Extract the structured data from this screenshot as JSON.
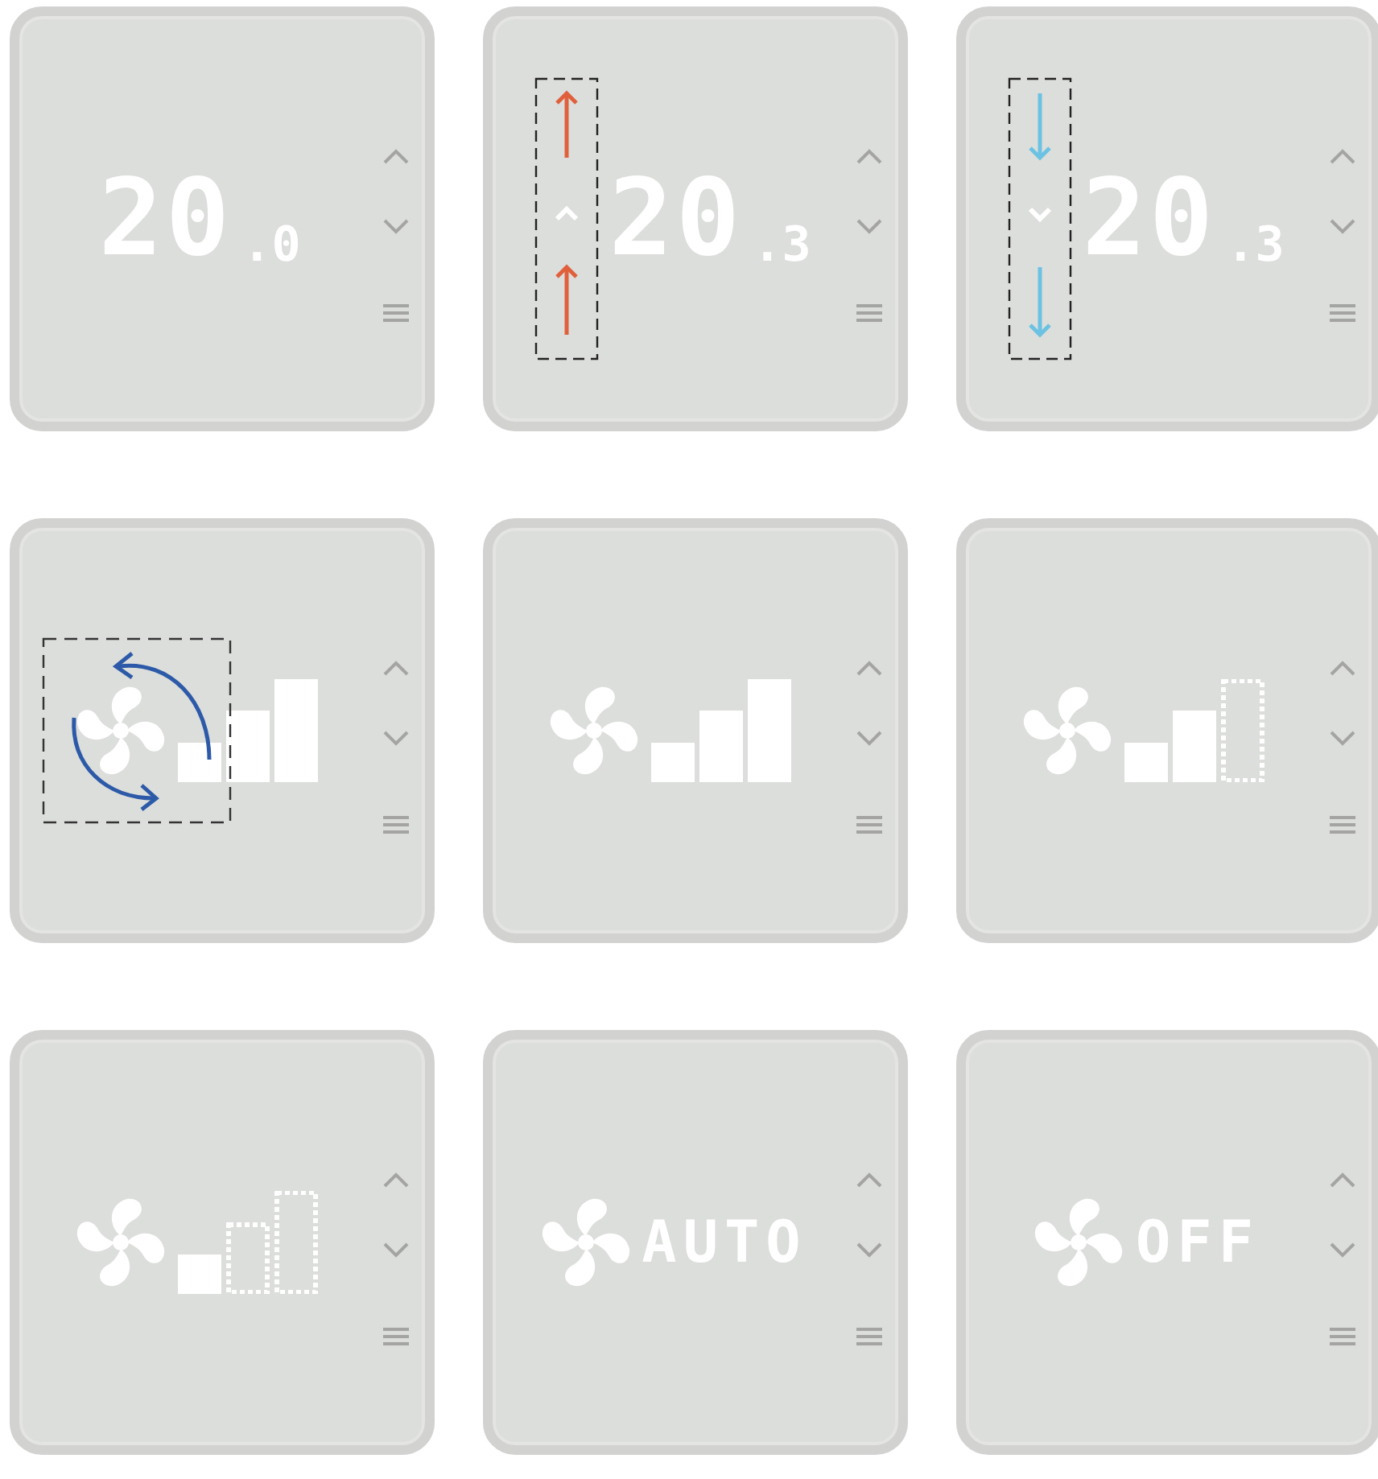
{
  "devices": [
    {
      "kind": "temperature",
      "whole": "20",
      "fraction": ".0",
      "rising": false,
      "falling": false
    },
    {
      "kind": "temperature",
      "whole": "20",
      "fraction": ".3",
      "rising": true,
      "falling": false
    },
    {
      "kind": "temperature",
      "whole": "20",
      "fraction": ".3",
      "rising": false,
      "falling": true
    },
    {
      "kind": "fan_level",
      "annotated": true,
      "bars": [
        {
          "filled": true
        },
        {
          "filled": true
        },
        {
          "filled": true
        }
      ]
    },
    {
      "kind": "fan_level",
      "annotated": false,
      "bars": [
        {
          "filled": true
        },
        {
          "filled": true
        },
        {
          "filled": true
        }
      ]
    },
    {
      "kind": "fan_level",
      "annotated": false,
      "bars": [
        {
          "filled": true
        },
        {
          "filled": true
        },
        {
          "filled": false
        }
      ]
    },
    {
      "kind": "fan_level",
      "annotated": false,
      "bars": [
        {
          "filled": true
        },
        {
          "filled": false
        },
        {
          "filled": false
        }
      ]
    },
    {
      "kind": "fan_mode",
      "mode": "AUTO"
    },
    {
      "kind": "fan_mode",
      "mode": "OFF"
    }
  ]
}
